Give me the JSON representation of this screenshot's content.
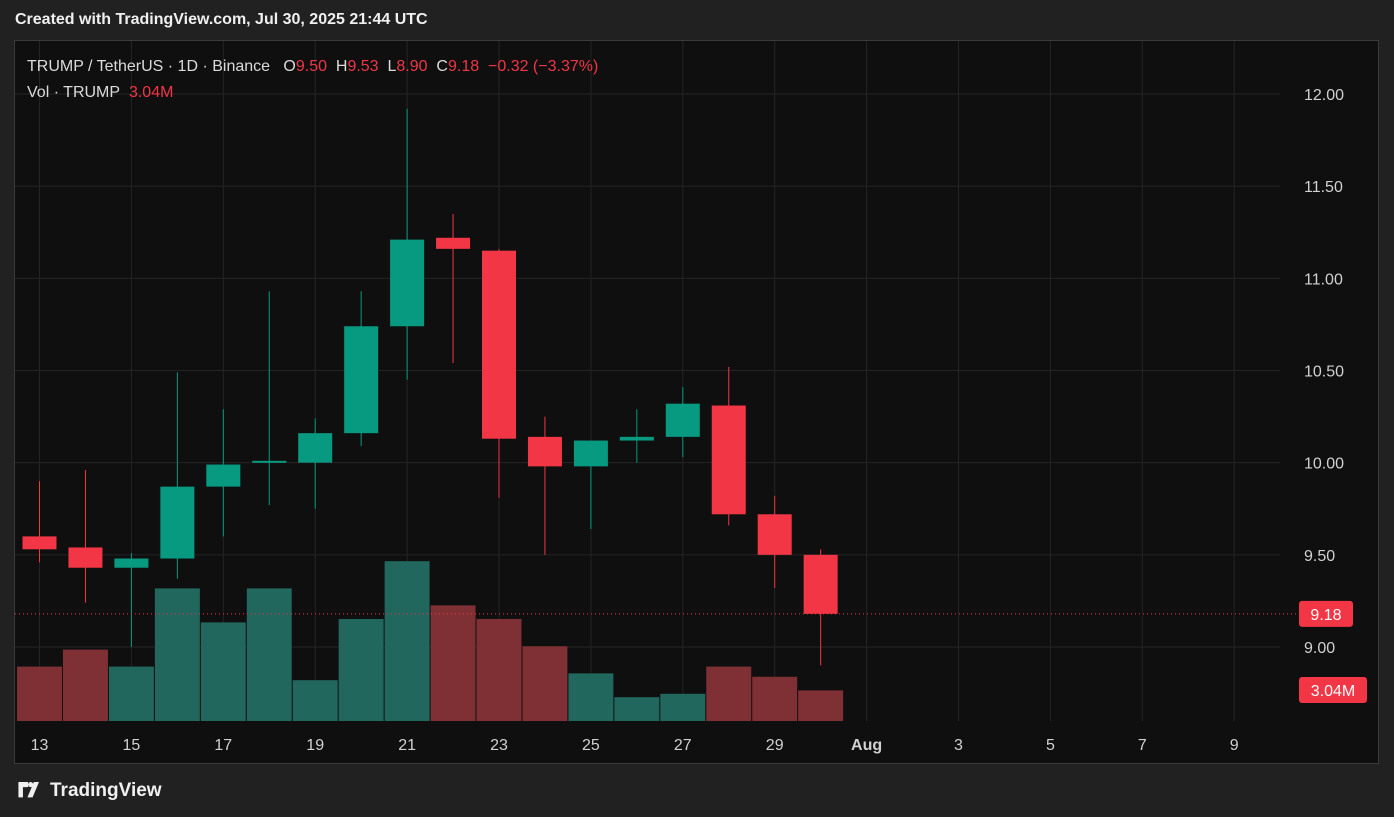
{
  "header": {
    "caption": "Created with TradingView.com, Jul 30, 2025 21:44 UTC"
  },
  "legend": {
    "symbol": "TRUMP / TetherUS · 1D · Binance",
    "o_label": "O",
    "o_value": "9.50",
    "h_label": "H",
    "h_value": "9.53",
    "l_label": "L",
    "l_value": "8.90",
    "c_label": "C",
    "c_value": "9.18",
    "change": "−0.32 (−3.37%)",
    "vol_label": "Vol · TRUMP",
    "vol_value": "3.04M"
  },
  "footer": {
    "brand": "TradingView"
  },
  "colors": {
    "up": "#089981",
    "down": "#f23645",
    "up_vol": "#22675e",
    "down_vol": "#7f3035",
    "background": "#0f0f0f",
    "grid": "#242424"
  },
  "chart_data": {
    "type": "candlestick",
    "y_axis": {
      "range": [
        8.6,
        12.3
      ],
      "ticks": [
        "12.00",
        "11.50",
        "11.00",
        "10.50",
        "10.00",
        "9.50",
        "9.00"
      ]
    },
    "x_axis": {
      "ticks": [
        "13",
        "15",
        "17",
        "19",
        "21",
        "23",
        "25",
        "27",
        "29",
        "Aug",
        "3",
        "5",
        "7",
        "9"
      ]
    },
    "last_price": "9.18",
    "last_volume": "3.04M",
    "candles": [
      {
        "date": "Jul 13",
        "open": 9.6,
        "high": 9.9,
        "low": 9.46,
        "close": 9.53,
        "volume": 1.6
      },
      {
        "date": "Jul 14",
        "open": 9.54,
        "high": 9.96,
        "low": 9.24,
        "close": 9.43,
        "volume": 2.1
      },
      {
        "date": "Jul 15",
        "open": 9.43,
        "high": 9.51,
        "low": 9.0,
        "close": 9.48,
        "volume": 1.6
      },
      {
        "date": "Jul 16",
        "open": 9.48,
        "high": 10.49,
        "low": 9.37,
        "close": 9.87,
        "volume": 3.9
      },
      {
        "date": "Jul 17",
        "open": 9.87,
        "high": 10.29,
        "low": 9.6,
        "close": 9.99,
        "volume": 2.9
      },
      {
        "date": "Jul 18",
        "open": 10.0,
        "high": 10.93,
        "low": 9.77,
        "close": 10.01,
        "volume": 3.9
      },
      {
        "date": "Jul 19",
        "open": 10.0,
        "high": 10.24,
        "low": 9.75,
        "close": 10.16,
        "volume": 1.2
      },
      {
        "date": "Jul 20",
        "open": 10.16,
        "high": 10.93,
        "low": 10.09,
        "close": 10.74,
        "volume": 3.0
      },
      {
        "date": "Jul 21",
        "open": 10.74,
        "high": 11.92,
        "low": 10.45,
        "close": 11.21,
        "volume": 4.7
      },
      {
        "date": "Jul 22",
        "open": 11.22,
        "high": 11.35,
        "low": 10.54,
        "close": 11.16,
        "volume": 3.4
      },
      {
        "date": "Jul 23",
        "open": 11.15,
        "high": 11.16,
        "low": 9.81,
        "close": 10.13,
        "volume": 3.0
      },
      {
        "date": "Jul 24",
        "open": 10.14,
        "high": 10.25,
        "low": 9.5,
        "close": 9.98,
        "volume": 2.2
      },
      {
        "date": "Jul 25",
        "open": 9.98,
        "high": 10.12,
        "low": 9.64,
        "close": 10.12,
        "volume": 1.4
      },
      {
        "date": "Jul 26",
        "open": 10.12,
        "high": 10.29,
        "low": 10.0,
        "close": 10.14,
        "volume": 0.7
      },
      {
        "date": "Jul 27",
        "open": 10.14,
        "high": 10.41,
        "low": 10.03,
        "close": 10.32,
        "volume": 0.8
      },
      {
        "date": "Jul 28",
        "open": 10.31,
        "high": 10.52,
        "low": 9.66,
        "close": 9.72,
        "volume": 1.6
      },
      {
        "date": "Jul 29",
        "open": 9.72,
        "high": 9.82,
        "low": 9.32,
        "close": 9.5,
        "volume": 1.3
      },
      {
        "date": "Jul 30",
        "open": 9.5,
        "high": 9.53,
        "low": 8.9,
        "close": 9.18,
        "volume": 0.9
      }
    ]
  }
}
